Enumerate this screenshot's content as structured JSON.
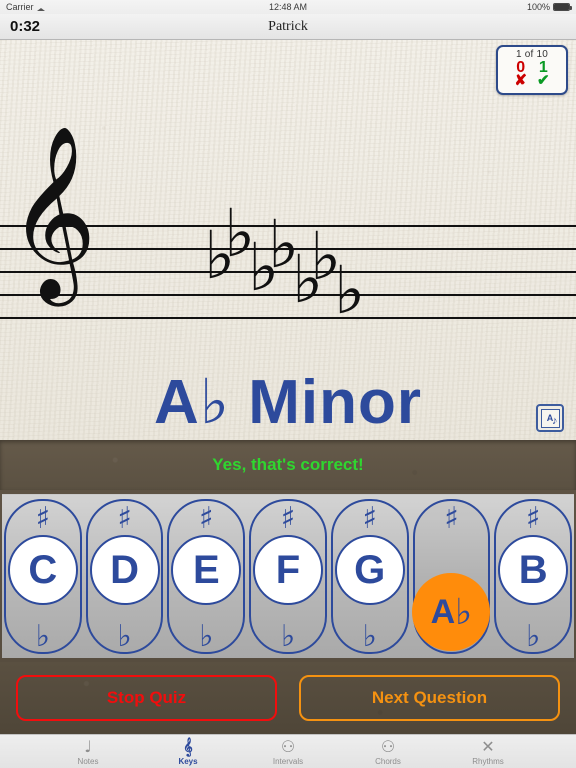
{
  "statusbar": {
    "carrier": "Carrier",
    "wifi_icon": "wifi-icon",
    "time": "12:48 AM",
    "battery_pct": "100%",
    "battery_icon": "battery-icon"
  },
  "navbar": {
    "timer": "0:32",
    "title": "Patrick"
  },
  "score_badge": {
    "count_label": "1 of 10",
    "wrong_value": "0",
    "wrong_mark": "✘",
    "right_value": "1",
    "right_mark": "✔",
    "wrong_color": "#cc0000",
    "right_color": "#0a9a24"
  },
  "staff": {
    "clef_glyph": "𝄞",
    "clef_name": "treble-clef",
    "line_count": 5,
    "key_signature": {
      "accidental": "♭",
      "count": 7,
      "flats": [
        "B♭",
        "E♭",
        "A♭",
        "D♭",
        "G♭",
        "C♭",
        "F♭"
      ]
    }
  },
  "answer": {
    "letter": "A",
    "accidental": "♭",
    "quality": "Minor",
    "color": "#2d4a9c"
  },
  "note_toggle": {
    "label": "A",
    "name": "note-name-toggle-icon"
  },
  "feedback": {
    "text": "Yes, that's correct!",
    "color": "#2fd62f"
  },
  "keyboard": {
    "sharp_symbol": "♯",
    "flat_symbol": "♭",
    "selected_index": 5,
    "selected_accidental": "♭",
    "selected_color": "#ff8c0b",
    "keys": [
      {
        "letter": "C",
        "selected": false
      },
      {
        "letter": "D",
        "selected": false
      },
      {
        "letter": "E",
        "selected": false
      },
      {
        "letter": "F",
        "selected": false
      },
      {
        "letter": "G",
        "selected": false
      },
      {
        "letter": "A",
        "selected": true
      },
      {
        "letter": "B",
        "selected": false
      }
    ]
  },
  "actions": {
    "stop_label": "Stop Quiz",
    "stop_color": "#f20d0d",
    "next_label": "Next Question",
    "next_color": "#f59211"
  },
  "tabbar": {
    "active_index": 1,
    "tabs": [
      {
        "label": "Notes",
        "icon": "quarter-note-icon",
        "glyph": "♩"
      },
      {
        "label": "Keys",
        "icon": "treble-clef-sharp-icon",
        "glyph": "𝄞"
      },
      {
        "label": "Intervals",
        "icon": "two-notes-stacked-icon",
        "glyph": "⚇"
      },
      {
        "label": "Chords",
        "icon": "three-notes-stacked-icon",
        "glyph": "⚇"
      },
      {
        "label": "Rhythms",
        "icon": "rhythm-x-notes-icon",
        "glyph": "✕"
      }
    ]
  }
}
